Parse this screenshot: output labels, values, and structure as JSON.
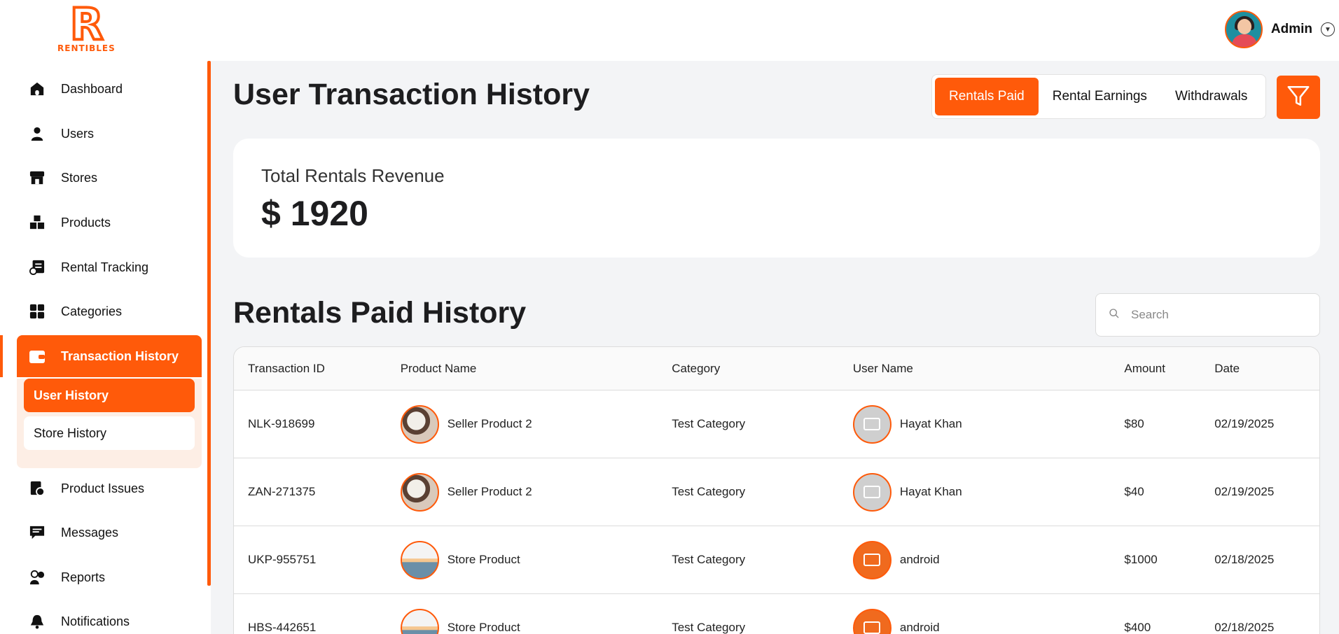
{
  "brand": {
    "logo_letter": "R",
    "logo_text": "RENTIBLES",
    "accent": "#ff5a0a"
  },
  "header": {
    "user_name": "Admin"
  },
  "sidebar": {
    "items": [
      {
        "label": "Dashboard",
        "icon": "home-icon"
      },
      {
        "label": "Users",
        "icon": "user-icon"
      },
      {
        "label": "Stores",
        "icon": "store-icon"
      },
      {
        "label": "Products",
        "icon": "boxes-icon"
      },
      {
        "label": "Rental Tracking",
        "icon": "tracking-icon"
      },
      {
        "label": "Categories",
        "icon": "grid-icon"
      },
      {
        "label": "Transaction History",
        "icon": "wallet-icon"
      },
      {
        "label": "Product Issues",
        "icon": "issue-icon"
      },
      {
        "label": "Messages",
        "icon": "message-icon"
      },
      {
        "label": "Reports",
        "icon": "reports-icon"
      },
      {
        "label": "Notifications",
        "icon": "bell-icon"
      }
    ],
    "submenu": [
      {
        "label": "User History"
      },
      {
        "label": "Store History"
      }
    ]
  },
  "main": {
    "title": "User Transaction History",
    "tabs": [
      {
        "label": "Rentals Paid"
      },
      {
        "label": "Rental Earnings"
      },
      {
        "label": "Withdrawals"
      }
    ],
    "revenue": {
      "label": "Total Rentals Revenue",
      "value": "$ 1920"
    },
    "section_title": "Rentals Paid History",
    "search": {
      "placeholder": "Search",
      "value": ""
    },
    "table": {
      "columns": [
        "Transaction ID",
        "Product Name",
        "Category",
        "User Name",
        "Amount",
        "Date"
      ],
      "rows": [
        {
          "id": "NLK-918699",
          "product": "Seller Product 2",
          "category": "Test Category",
          "user": "Hayat Khan",
          "amount": "$80",
          "date": "02/19/2025"
        },
        {
          "id": "ZAN-271375",
          "product": "Seller Product 2",
          "category": "Test Category",
          "user": "Hayat Khan",
          "amount": "$40",
          "date": "02/19/2025"
        },
        {
          "id": "UKP-955751",
          "product": "Store Product",
          "category": "Test Category",
          "user": "android",
          "amount": "$1000",
          "date": "02/18/2025"
        },
        {
          "id": "HBS-442651",
          "product": "Store Product",
          "category": "Test Category",
          "user": "android",
          "amount": "$400",
          "date": "02/18/2025"
        }
      ]
    }
  }
}
